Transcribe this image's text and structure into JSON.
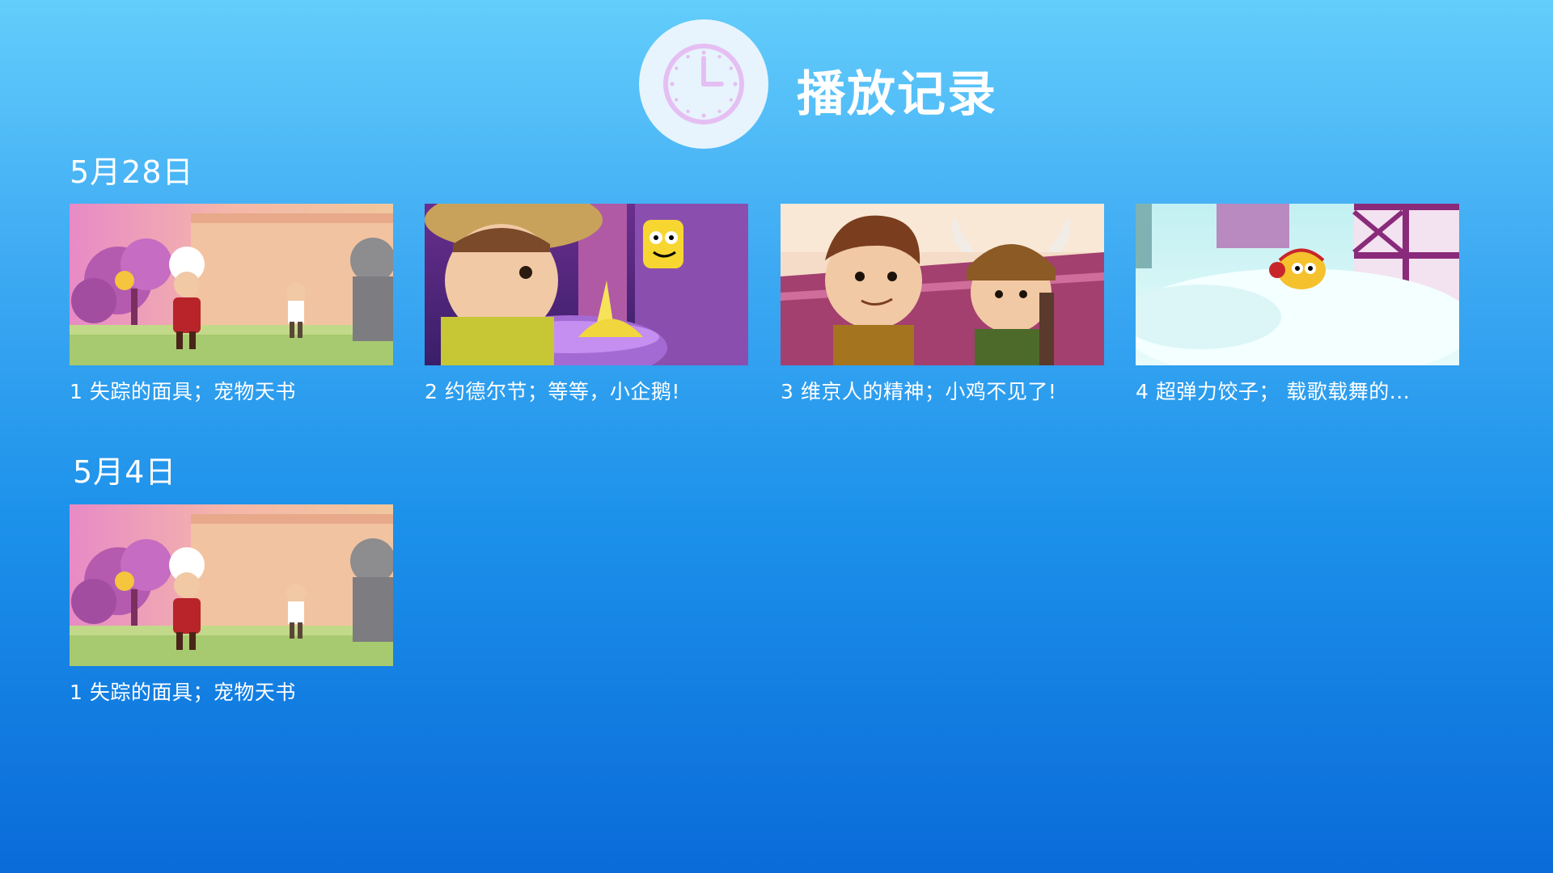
{
  "header": {
    "title": "播放记录",
    "icon": "clock-icon"
  },
  "sections": [
    {
      "date": "5月28日",
      "items": [
        {
          "label": "1 失踪的面具；宠物天书",
          "scene": "castle-wall"
        },
        {
          "label": "2 约德尔节；等等，小企鹅!",
          "scene": "purple-hall"
        },
        {
          "label": "3 维京人的精神；小鸡不见了!",
          "scene": "viking-ship"
        },
        {
          "label": "4 超弹力饺子； 载歌载舞的...",
          "scene": "snow-village"
        }
      ]
    },
    {
      "date": "5月4日",
      "items": [
        {
          "label": "1 失踪的面具；宠物天书",
          "scene": "castle-wall"
        }
      ]
    }
  ],
  "colors": {
    "background_top": "#63cdfb",
    "background_bottom": "#0a6bd9",
    "clock_circle": "#e7f4fd",
    "clock_stroke": "#e7c1f4",
    "text": "#ffffff"
  }
}
